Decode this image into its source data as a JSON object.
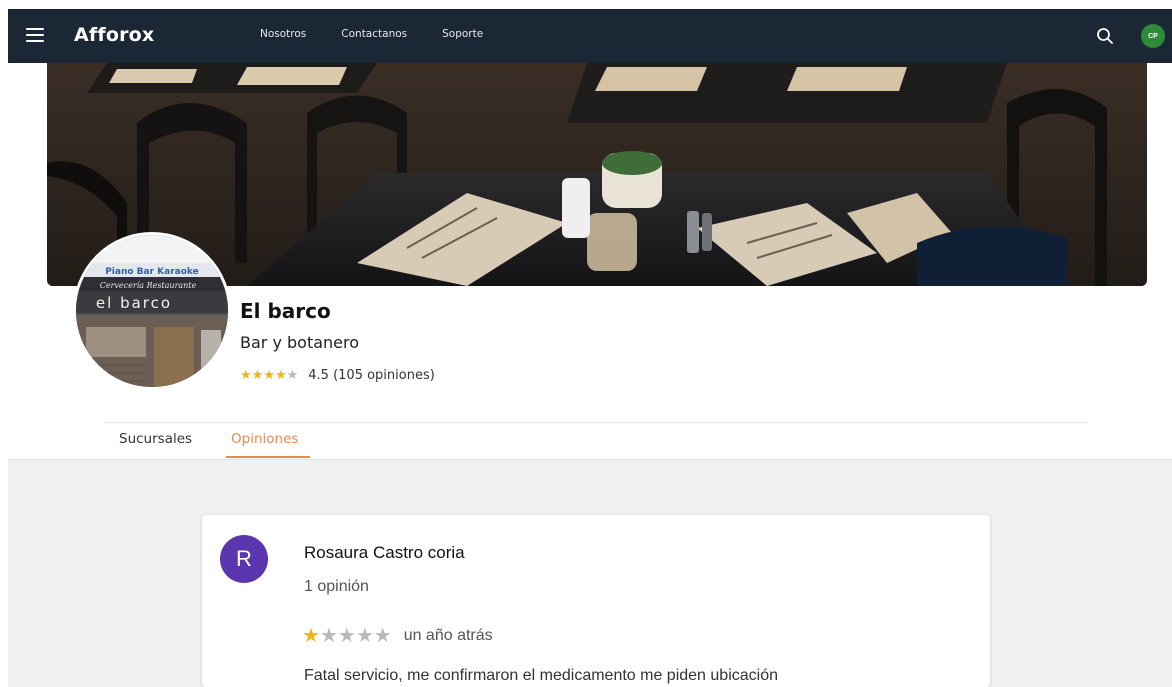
{
  "nav": {
    "brand": "Afforox",
    "links": [
      "Nosotros",
      "Contactanos",
      "Soporte"
    ],
    "user_initials": "CP"
  },
  "colors": {
    "nav_bg": "#1c2735",
    "accent": "#e98a4b",
    "star": "#f2b41d",
    "user_avatar": "#2f8a3a",
    "reviewer_avatar": "#5b35ae"
  },
  "business": {
    "photo_sign_top": "Piano Bar Karaoke",
    "photo_sign_mid": "Cervecería Restaurante",
    "photo_sign_name": "el barco",
    "name": "El barco",
    "category": "Bar y botanero",
    "rating": 4.5,
    "rating_text": "4.5 (105 opiniones)"
  },
  "tabs": {
    "sucursales": "Sucursales",
    "opiniones": "Opiniones",
    "active": "Opiniones"
  },
  "review": {
    "avatar_letter": "R",
    "author": "Rosaura Castro coria",
    "author_count": "1 opinión",
    "rating": 1,
    "time": "un año atrás",
    "text": "Fatal servicio, me confirmaron el medicamento me piden ubicación"
  }
}
